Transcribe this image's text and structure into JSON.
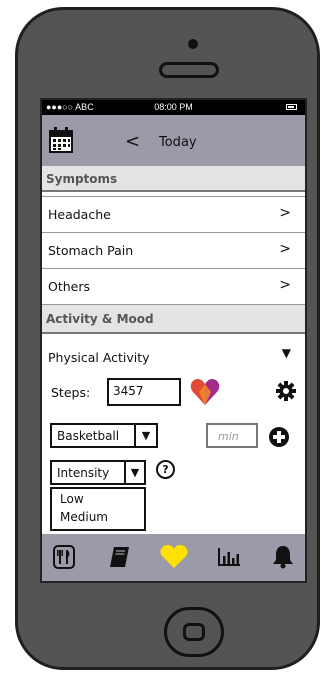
{
  "status": {
    "carrier": "●●●○○ ABC",
    "time": "08:00 PM"
  },
  "nav": {
    "title": "Today",
    "back_glyph": "<"
  },
  "sections": {
    "symptoms": "Symptoms",
    "activity": "Activity & Mood"
  },
  "symptoms": {
    "items": [
      {
        "label": "Headache",
        "chevron": ">"
      },
      {
        "label": "Stomach Pain",
        "chevron": ">"
      },
      {
        "label": "Others",
        "chevron": ">"
      }
    ]
  },
  "activity": {
    "physical_label": "Physical Activity",
    "steps_label": "Steps:",
    "steps_value": "3457",
    "sport_value": "Basketball",
    "minutes_placeholder": "min",
    "intensity_value": "Intensity",
    "intensity_options": [
      "Low",
      "Medium"
    ],
    "help_glyph": "?"
  },
  "tabs": [
    "utensils-icon",
    "book-icon",
    "heart-icon",
    "bar-chart-icon",
    "bell-icon"
  ],
  "colors": {
    "bar": "#9a9aa8",
    "heart_tab": "#ffe000",
    "heart_a": "#e24a33",
    "heart_b": "#a32c8a"
  }
}
